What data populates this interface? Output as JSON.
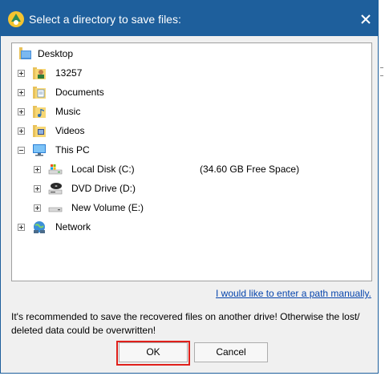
{
  "dialog": {
    "title": "Select a directory to save files:",
    "close_icon": "close-icon",
    "app_icon": "app-icon"
  },
  "tree": {
    "root": {
      "label": "Desktop",
      "icon": "desktop-folder-icon"
    },
    "items": [
      {
        "label": "13257",
        "icon": "user-folder-icon",
        "expander": "plus"
      },
      {
        "label": "Documents",
        "icon": "documents-folder-icon",
        "expander": "plus"
      },
      {
        "label": "Music",
        "icon": "music-folder-icon",
        "expander": "plus"
      },
      {
        "label": "Videos",
        "icon": "videos-folder-icon",
        "expander": "plus"
      },
      {
        "label": "This PC",
        "icon": "computer-icon",
        "expander": "minus"
      }
    ],
    "drives": [
      {
        "label": "Local Disk (C:)",
        "free": "(34.60 GB Free Space)",
        "icon": "local-disk-icon",
        "expander": "plus"
      },
      {
        "label": "DVD Drive (D:)",
        "free": "",
        "icon": "dvd-drive-icon",
        "expander": "plus"
      },
      {
        "label": "New Volume (E:)",
        "free": "",
        "icon": "drive-icon",
        "expander": "plus"
      }
    ],
    "network": {
      "label": "Network",
      "icon": "network-icon",
      "expander": "plus"
    }
  },
  "manual_path_link": "I would like to enter a path manually.",
  "message_line1": "It's recommended to save the recovered files on another drive! Otherwise the lost/",
  "message_line2": "deleted data could be overwritten!",
  "buttons": {
    "ok": "OK",
    "cancel": "Cancel"
  },
  "colors": {
    "titlebar": "#1e5f9c",
    "highlight": "#e0201b",
    "link": "#0645ad"
  }
}
